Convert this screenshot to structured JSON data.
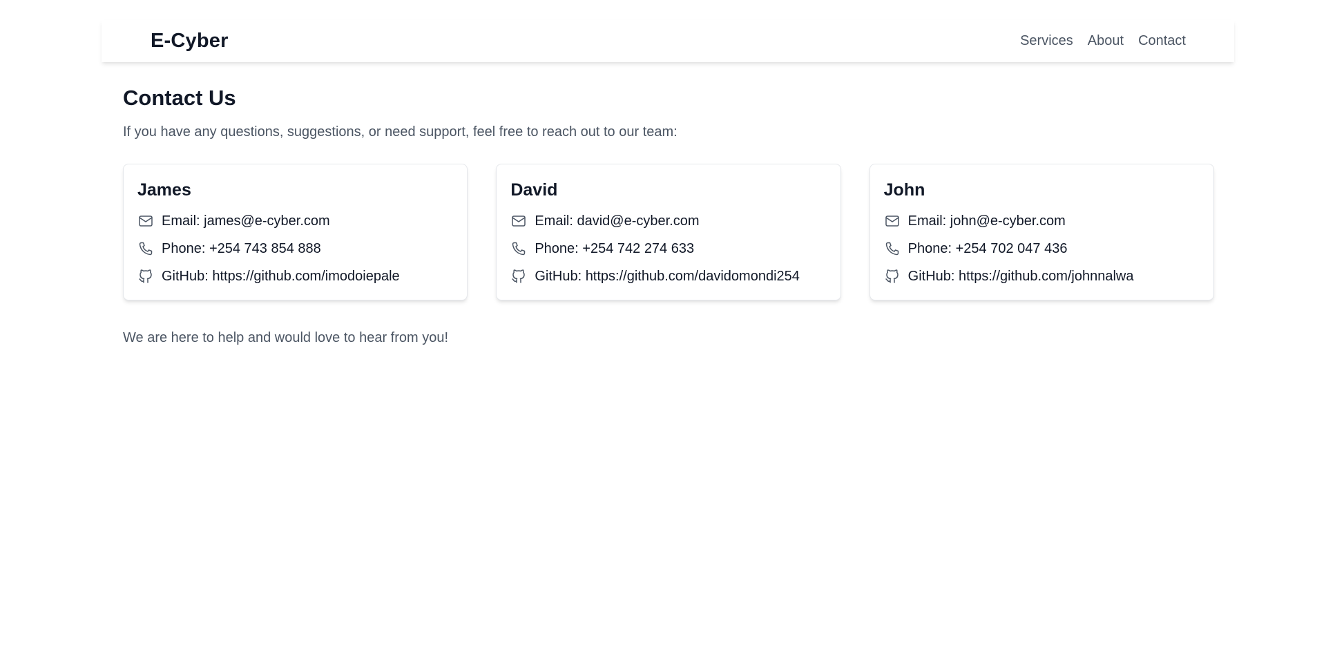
{
  "header": {
    "brand": "E-Cyber",
    "nav": [
      {
        "label": "Services"
      },
      {
        "label": "About"
      },
      {
        "label": "Contact"
      }
    ]
  },
  "main": {
    "title": "Contact Us",
    "intro": "If you have any questions, suggestions, or need support, feel free to reach out to our team:",
    "outro": "We are here to help and would love to hear from you!"
  },
  "contacts": [
    {
      "name": "James",
      "email_prefix": "Email: ",
      "email": "james@e-cyber.com",
      "phone_prefix": "Phone: ",
      "phone": "+254 743 854 888",
      "github_prefix": "GitHub: ",
      "github": "https://github.com/imodoiepale"
    },
    {
      "name": "David",
      "email_prefix": "Email: ",
      "email": "david@e-cyber.com",
      "phone_prefix": "Phone: ",
      "phone": "+254 742 274 633",
      "github_prefix": "GitHub: ",
      "github": "https://github.com/davidomondi254"
    },
    {
      "name": "John",
      "email_prefix": "Email: ",
      "email": "john@e-cyber.com",
      "phone_prefix": "Phone: ",
      "phone": "+254 702 047 436",
      "github_prefix": "GitHub: ",
      "github": "https://github.com/johnnalwa"
    }
  ],
  "icons": {
    "email": "mail-icon",
    "phone": "phone-icon",
    "github": "github-icon"
  },
  "colors": {
    "text_primary": "#111827",
    "text_secondary": "#4b5563",
    "icon": "#4b5563",
    "card_border": "#e5e7eb"
  }
}
